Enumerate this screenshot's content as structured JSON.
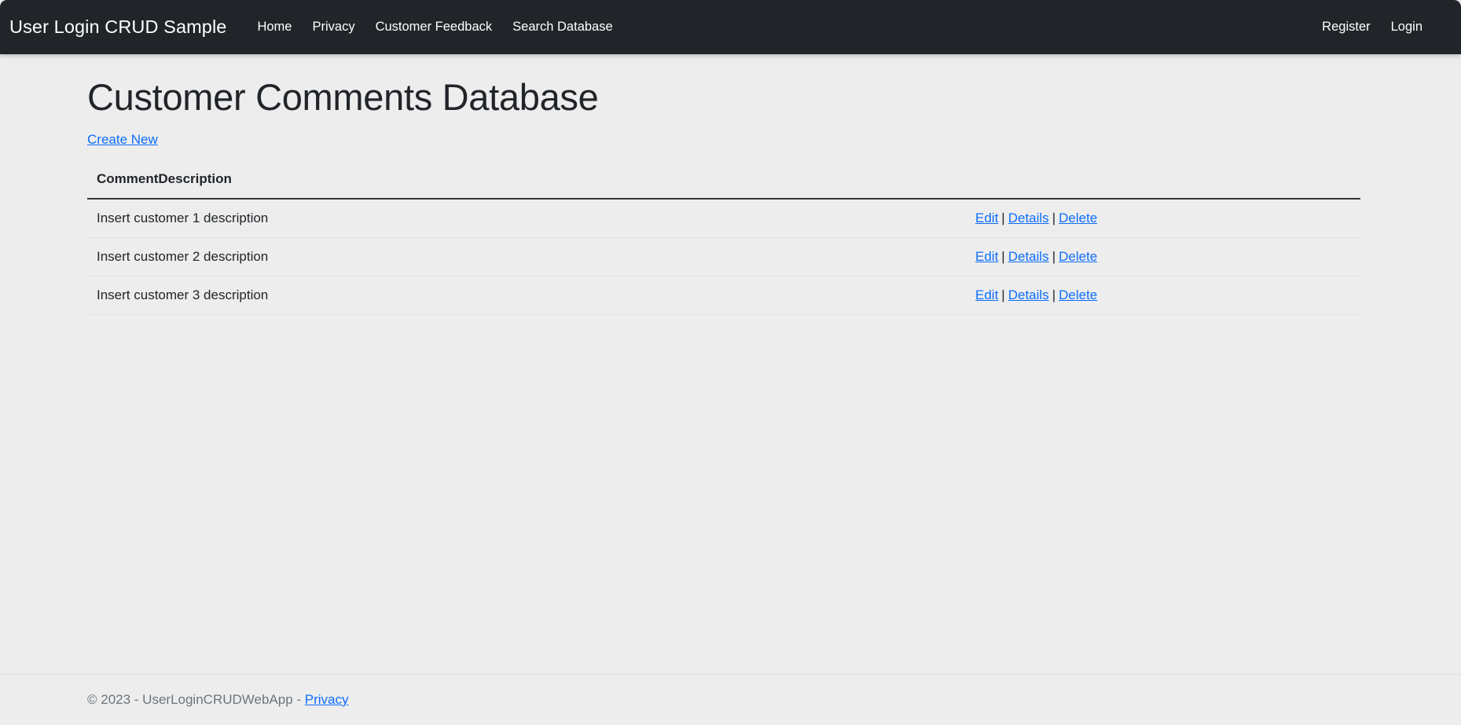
{
  "navbar": {
    "brand": "User Login CRUD Sample",
    "links": [
      {
        "label": "Home",
        "name": "nav-link-home"
      },
      {
        "label": "Privacy",
        "name": "nav-link-privacy"
      },
      {
        "label": "Customer Feedback",
        "name": "nav-link-customer-feedback"
      },
      {
        "label": "Search Database",
        "name": "nav-link-search-database"
      }
    ],
    "right_links": [
      {
        "label": "Register",
        "name": "nav-link-register"
      },
      {
        "label": "Login",
        "name": "nav-link-login"
      }
    ],
    "background_color": "#212529",
    "text_color": "#ffffff"
  },
  "main": {
    "page_title": "Customer Comments Database",
    "create_new_label": "Create New",
    "table": {
      "columns": [
        "CommentDescription"
      ],
      "rows": [
        {
          "description": "Insert customer 1 description",
          "actions": {
            "edit": "Edit",
            "details": "Details",
            "delete": "Delete"
          }
        },
        {
          "description": "Insert customer 2 description",
          "actions": {
            "edit": "Edit",
            "details": "Details",
            "delete": "Delete"
          }
        },
        {
          "description": "Insert customer 3 description",
          "actions": {
            "edit": "Edit",
            "details": "Details",
            "delete": "Delete"
          }
        }
      ],
      "action_separator": "|"
    }
  },
  "footer": {
    "copyright_prefix": "© 2023 - UserLoginCRUDWebApp - ",
    "privacy_label": "Privacy"
  },
  "theme": {
    "link_color": "#0d6efd",
    "body_background": "#ededed",
    "muted_text": "#6c757d"
  }
}
